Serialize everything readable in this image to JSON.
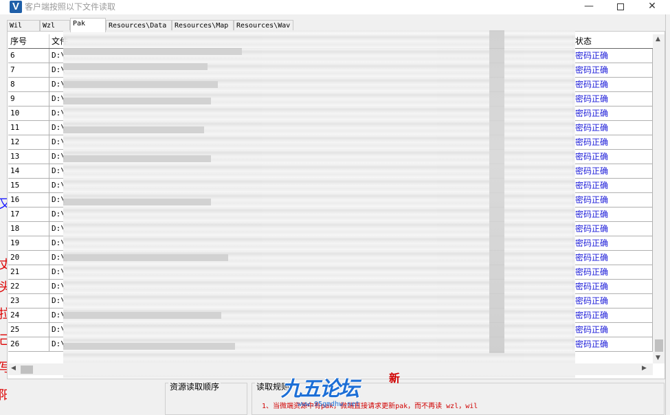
{
  "window": {
    "title": "客户端按照以下文件读取",
    "icon_letter": "V"
  },
  "tabs": [
    {
      "label": "Wil"
    },
    {
      "label": "Wzl"
    },
    {
      "label": "Pak"
    },
    {
      "label": "Resources\\Data"
    },
    {
      "label": "Resources\\Map"
    },
    {
      "label": "Resources\\Wav"
    }
  ],
  "grid": {
    "columns": [
      "序号",
      "文件",
      "状态"
    ],
    "rows": [
      {
        "index": "6",
        "path": "D:\\",
        "status": "密码正确"
      },
      {
        "index": "7",
        "path": "D:\\",
        "status": "密码正确"
      },
      {
        "index": "8",
        "path": "D:\\",
        "status": "密码正确"
      },
      {
        "index": "9",
        "path": "D:\\",
        "status": "密码正确"
      },
      {
        "index": "10",
        "path": "D:\\",
        "status": "密码正确"
      },
      {
        "index": "11",
        "path": "D:\\",
        "status": "密码正确"
      },
      {
        "index": "12",
        "path": "D:\\",
        "status": "密码正确"
      },
      {
        "index": "13",
        "path": "D:\\",
        "status": "密码正确"
      },
      {
        "index": "14",
        "path": "D:\\",
        "status": "密码正确"
      },
      {
        "index": "15",
        "path": "D:\\",
        "status": "密码正确"
      },
      {
        "index": "16",
        "path": "D:\\",
        "status": "密码正确"
      },
      {
        "index": "17",
        "path": "D:\\",
        "status": "密码正确"
      },
      {
        "index": "18",
        "path": "D:\\",
        "status": "密码正确"
      },
      {
        "index": "19",
        "path": "D:\\",
        "status": "密码正确"
      },
      {
        "index": "20",
        "path": "D:\\",
        "status": "密码正确"
      },
      {
        "index": "21",
        "path": "D:\\",
        "status": "密码正确"
      },
      {
        "index": "22",
        "path": "D:\\",
        "status": "密码正确"
      },
      {
        "index": "23",
        "path": "D:\\",
        "status": "密码正确"
      },
      {
        "index": "24",
        "path": "D:\\",
        "status": "密码正确"
      },
      {
        "index": "25",
        "path": "D:\\",
        "status": "密码正确"
      },
      {
        "index": "26",
        "path": "D:\\",
        "status": "密码正确"
      }
    ]
  },
  "bottom": {
    "order_title": "资源读取顺序",
    "rules_title": "读取规则",
    "note": "1、当微端资源中有pak，微端直接请求更新pak，而不再读 wzl，wil"
  },
  "watermark": {
    "text": "九五论坛",
    "seal": "新",
    "url": "www.95gmdhw.net"
  },
  "colors": {
    "status_blue": "#1a1ad8",
    "note_red": "#d00000",
    "watermark_blue": "#1d6fd6"
  }
}
